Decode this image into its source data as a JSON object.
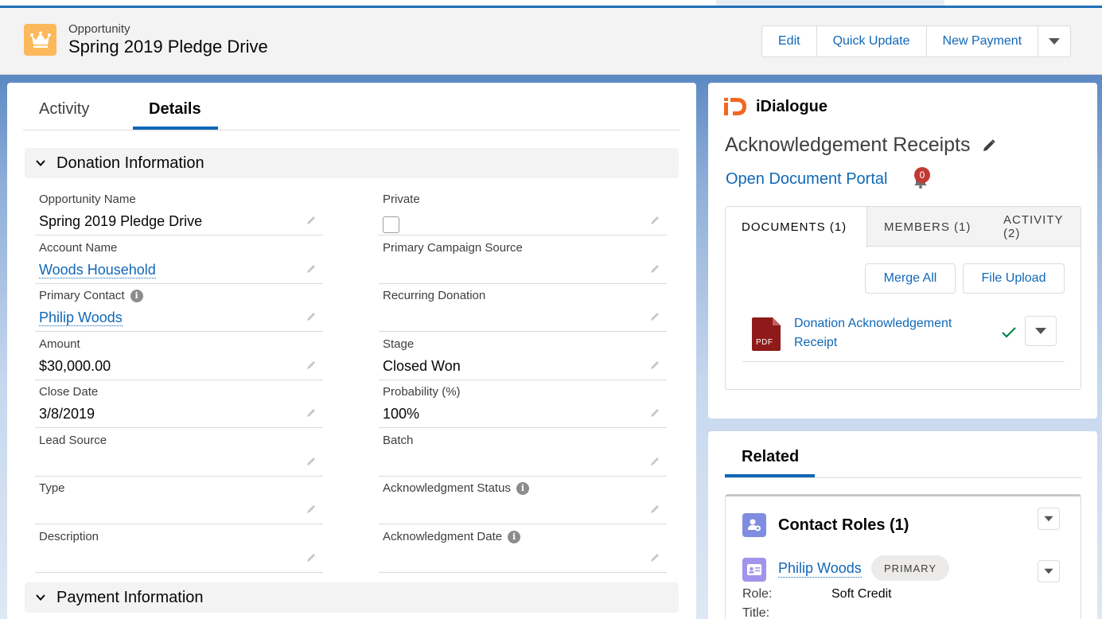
{
  "header": {
    "object_type": "Opportunity",
    "record_title": "Spring 2019 Pledge Drive",
    "icon": "crown-icon",
    "icon_color": "#fcb95b",
    "buttons": [
      "Edit",
      "Quick Update",
      "New Payment"
    ]
  },
  "left": {
    "tabs": [
      "Activity",
      "Details"
    ],
    "active_tab": "Details",
    "sections": {
      "donation": "Donation Information",
      "payment": "Payment Information"
    },
    "fields": {
      "opportunity_name": {
        "label": "Opportunity Name",
        "value": "Spring 2019 Pledge Drive"
      },
      "private": {
        "label": "Private",
        "checked": false
      },
      "account_name": {
        "label": "Account Name",
        "value": "Woods Household"
      },
      "primary_campaign_source": {
        "label": "Primary Campaign Source",
        "value": ""
      },
      "primary_contact": {
        "label": "Primary Contact",
        "value": "Philip Woods"
      },
      "recurring_donation": {
        "label": "Recurring Donation",
        "value": ""
      },
      "amount": {
        "label": "Amount",
        "value": "$30,000.00"
      },
      "stage": {
        "label": "Stage",
        "value": "Closed Won"
      },
      "close_date": {
        "label": "Close Date",
        "value": "3/8/2019"
      },
      "probability": {
        "label": "Probability (%)",
        "value": "100%"
      },
      "lead_source": {
        "label": "Lead Source",
        "value": ""
      },
      "batch": {
        "label": "Batch",
        "value": ""
      },
      "type": {
        "label": "Type",
        "value": ""
      },
      "acknowledgment_status": {
        "label": "Acknowledgment Status",
        "value": ""
      },
      "description": {
        "label": "Description",
        "value": ""
      },
      "acknowledgment_date": {
        "label": "Acknowledgment Date",
        "value": ""
      }
    }
  },
  "idialogue": {
    "brand": "iDialogue",
    "brand_color": "#f26722",
    "doc_title": "Acknowledgement Receipts",
    "portal_link": "Open Document Portal",
    "notification_count": "0",
    "tabs": [
      "DOCUMENTS (1)",
      "MEMBERS (1)",
      "ACTIVITY (2)"
    ],
    "merge_all": "Merge All",
    "file_upload": "File Upload",
    "document": {
      "name_line1": "Donation Acknowledgement",
      "name_line2": "Receipt",
      "file_type": "PDF",
      "status": "check-icon"
    }
  },
  "related": {
    "tab": "Related",
    "contact_roles": {
      "title": "Contact Roles (1)",
      "contact_name": "Philip Woods",
      "badge": "PRIMARY",
      "role_label": "Role:",
      "role_value": "Soft Credit",
      "title_label": "Title:"
    }
  }
}
